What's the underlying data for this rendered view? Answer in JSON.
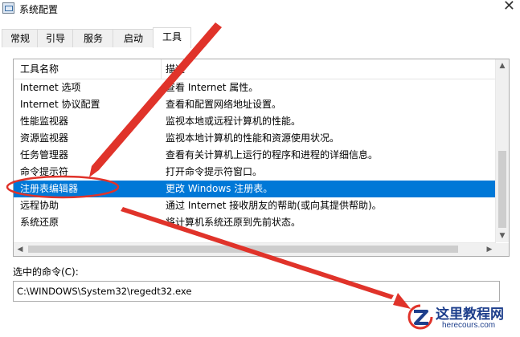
{
  "window": {
    "title": "系统配置",
    "close_glyph": "✕"
  },
  "tabs": [
    {
      "label": "常规",
      "active": false
    },
    {
      "label": "引导",
      "active": false
    },
    {
      "label": "服务",
      "active": false
    },
    {
      "label": "启动",
      "active": false
    },
    {
      "label": "工具",
      "active": true
    }
  ],
  "tools_list": {
    "columns": [
      "工具名称",
      "描述"
    ],
    "rows": [
      {
        "name": "Internet 选项",
        "desc": "查看 Internet 属性。"
      },
      {
        "name": "Internet 协议配置",
        "desc": "查看和配置网络地址设置。"
      },
      {
        "name": "性能监视器",
        "desc": "监视本地或远程计算机的性能。"
      },
      {
        "name": "资源监视器",
        "desc": "监视本地计算机的性能和资源使用状况。"
      },
      {
        "name": "任务管理器",
        "desc": "查看有关计算机上运行的程序和进程的详细信息。"
      },
      {
        "name": "命令提示符",
        "desc": "打开命令提示符窗口。"
      },
      {
        "name": "注册表编辑器",
        "desc": "更改 Windows 注册表。",
        "selected": true
      },
      {
        "name": "远程协助",
        "desc": "通过 Internet 接收朋友的帮助(或向其提供帮助)。"
      },
      {
        "name": "系统还原",
        "desc": "将计算机系统还原到先前状态。"
      }
    ]
  },
  "selected_command": {
    "label": "选中的命令(C):",
    "value": "C:\\WINDOWS\\System32\\regedt32.exe"
  },
  "annotation": {
    "color": "#e0332a"
  },
  "watermark": {
    "title": "这里教程网",
    "url": "herecours.com",
    "color": "#1e3f8c"
  },
  "colors": {
    "selection": "#0078d7",
    "accent_red": "#e0332a"
  }
}
